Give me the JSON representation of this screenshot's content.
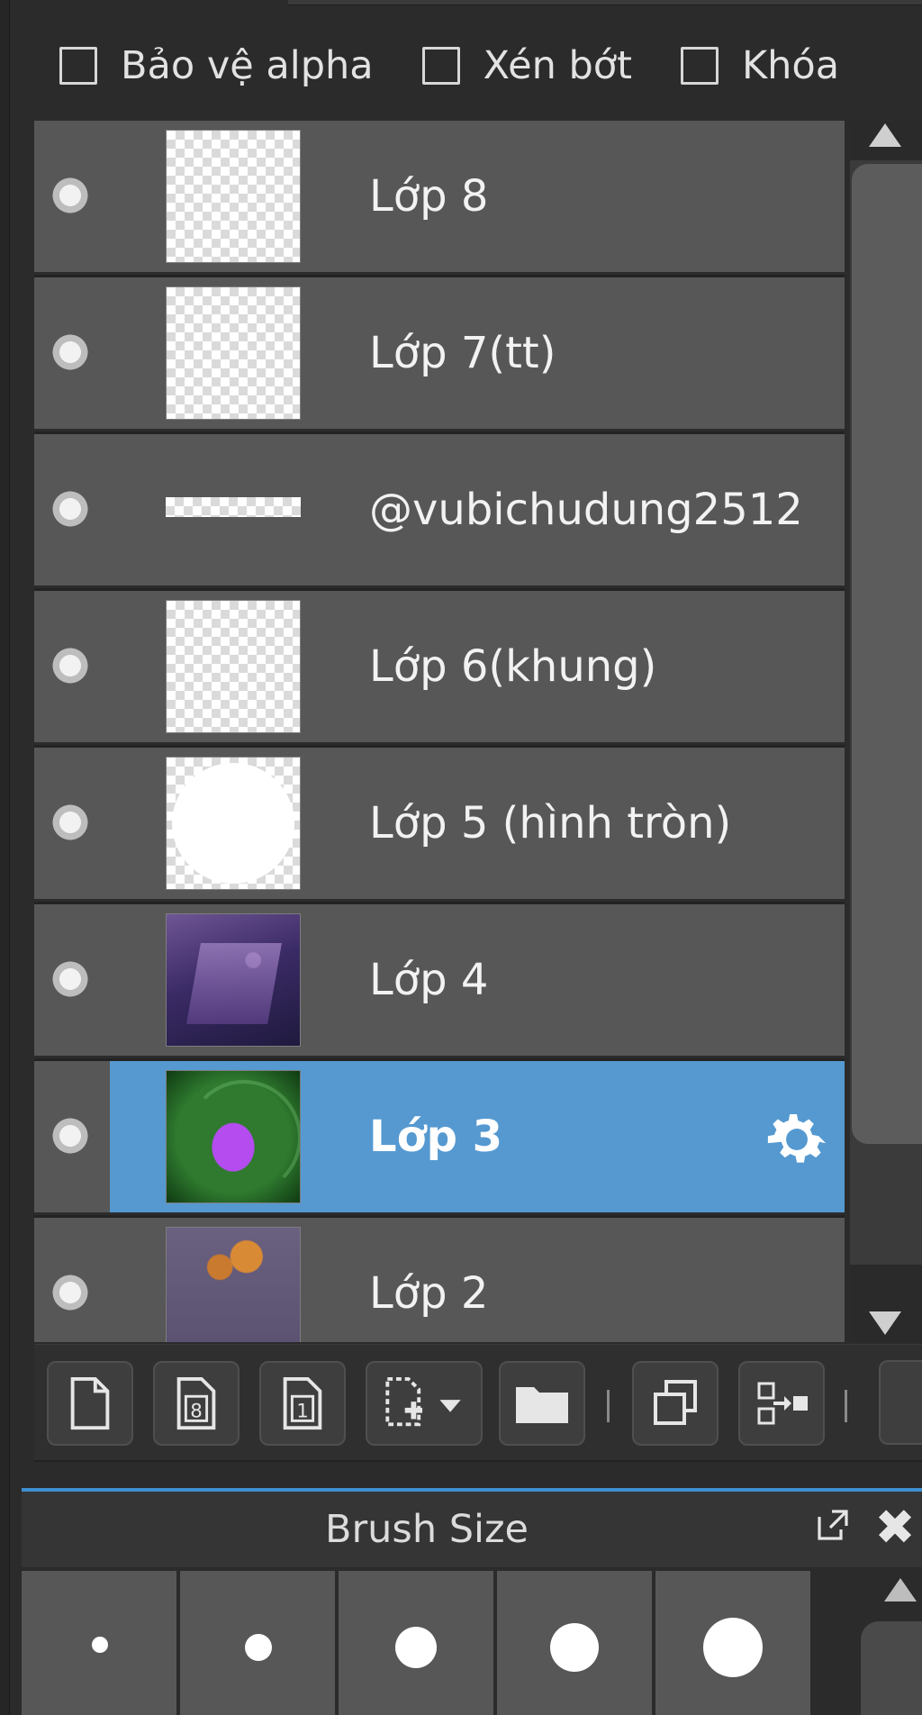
{
  "options": {
    "protect_alpha": "Bảo vệ alpha",
    "clipping": "Xén bớt",
    "lock": "Khóa"
  },
  "layers": [
    {
      "name": "Lớp 8",
      "thumb": "transparent",
      "selected": false
    },
    {
      "name": "Lớp 7(tt)",
      "thumb": "transparent",
      "selected": false
    },
    {
      "name": "@vubichudung2512",
      "thumb": "text-strip",
      "selected": false
    },
    {
      "name": "Lớp 6(khung)",
      "thumb": "transparent",
      "selected": false
    },
    {
      "name": "Lớp 5 (hình tròn)",
      "thumb": "white-circle",
      "selected": false
    },
    {
      "name": "Lớp 4",
      "thumb": "purple-photo",
      "selected": false
    },
    {
      "name": "Lớp 3",
      "thumb": "lotus-photo",
      "selected": true
    },
    {
      "name": "Lớp 2",
      "thumb": "orange-flower-photo",
      "selected": false
    }
  ],
  "toolbar": {
    "buttons": [
      "new-layer-icon",
      "new-8bit-layer-icon",
      "new-1bit-layer-icon",
      "add-layer-dropdown-icon",
      "new-folder-icon",
      "duplicate-layer-icon",
      "merge-layer-icon"
    ],
    "numbered_icon_labels": {
      "eight": "8",
      "one": "1"
    }
  },
  "brush_panel": {
    "title": "Brush Size",
    "sizes_count_visible": 5
  },
  "colors": {
    "selected_row": "#5599d0",
    "row": "#575757",
    "accent_line": "#3e8fcf"
  }
}
